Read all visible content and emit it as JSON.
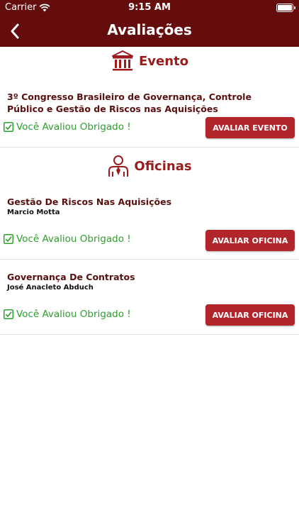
{
  "status_bar": {
    "carrier": "Carrier",
    "time": "9:15 AM"
  },
  "nav": {
    "title": "Avaliações"
  },
  "event_section": {
    "header": "Evento",
    "item": {
      "title": "3º Congresso Brasileiro de Governança, Controle Público e Gestão de Riscos nas Aquisições",
      "status": "Você Avaliou Obrigado !",
      "button": "AVALIAR EVENTO"
    }
  },
  "workshops_section": {
    "header": "Oficinas",
    "items": [
      {
        "title": "Gestão De Riscos Nas Aquisições",
        "presenter": "Marcio Motta",
        "status": "Você Avaliou Obrigado !",
        "button": "AVALIAR OFICINA"
      },
      {
        "title": "Governança De Contratos",
        "presenter": "José Anacleto Abduch",
        "status": "Você Avaliou Obrigado !",
        "button": "AVALIAR OFICINA"
      }
    ]
  },
  "colors": {
    "brand": "#650d0d",
    "accent": "#b2262b",
    "success": "#2e9e2e"
  },
  "icons": {
    "event": "institution-icon",
    "workshops": "presenter-icon",
    "status": "checkbox-checked-icon",
    "back": "chevron-left-icon",
    "wifi": "wifi-icon",
    "battery": "battery-icon"
  }
}
